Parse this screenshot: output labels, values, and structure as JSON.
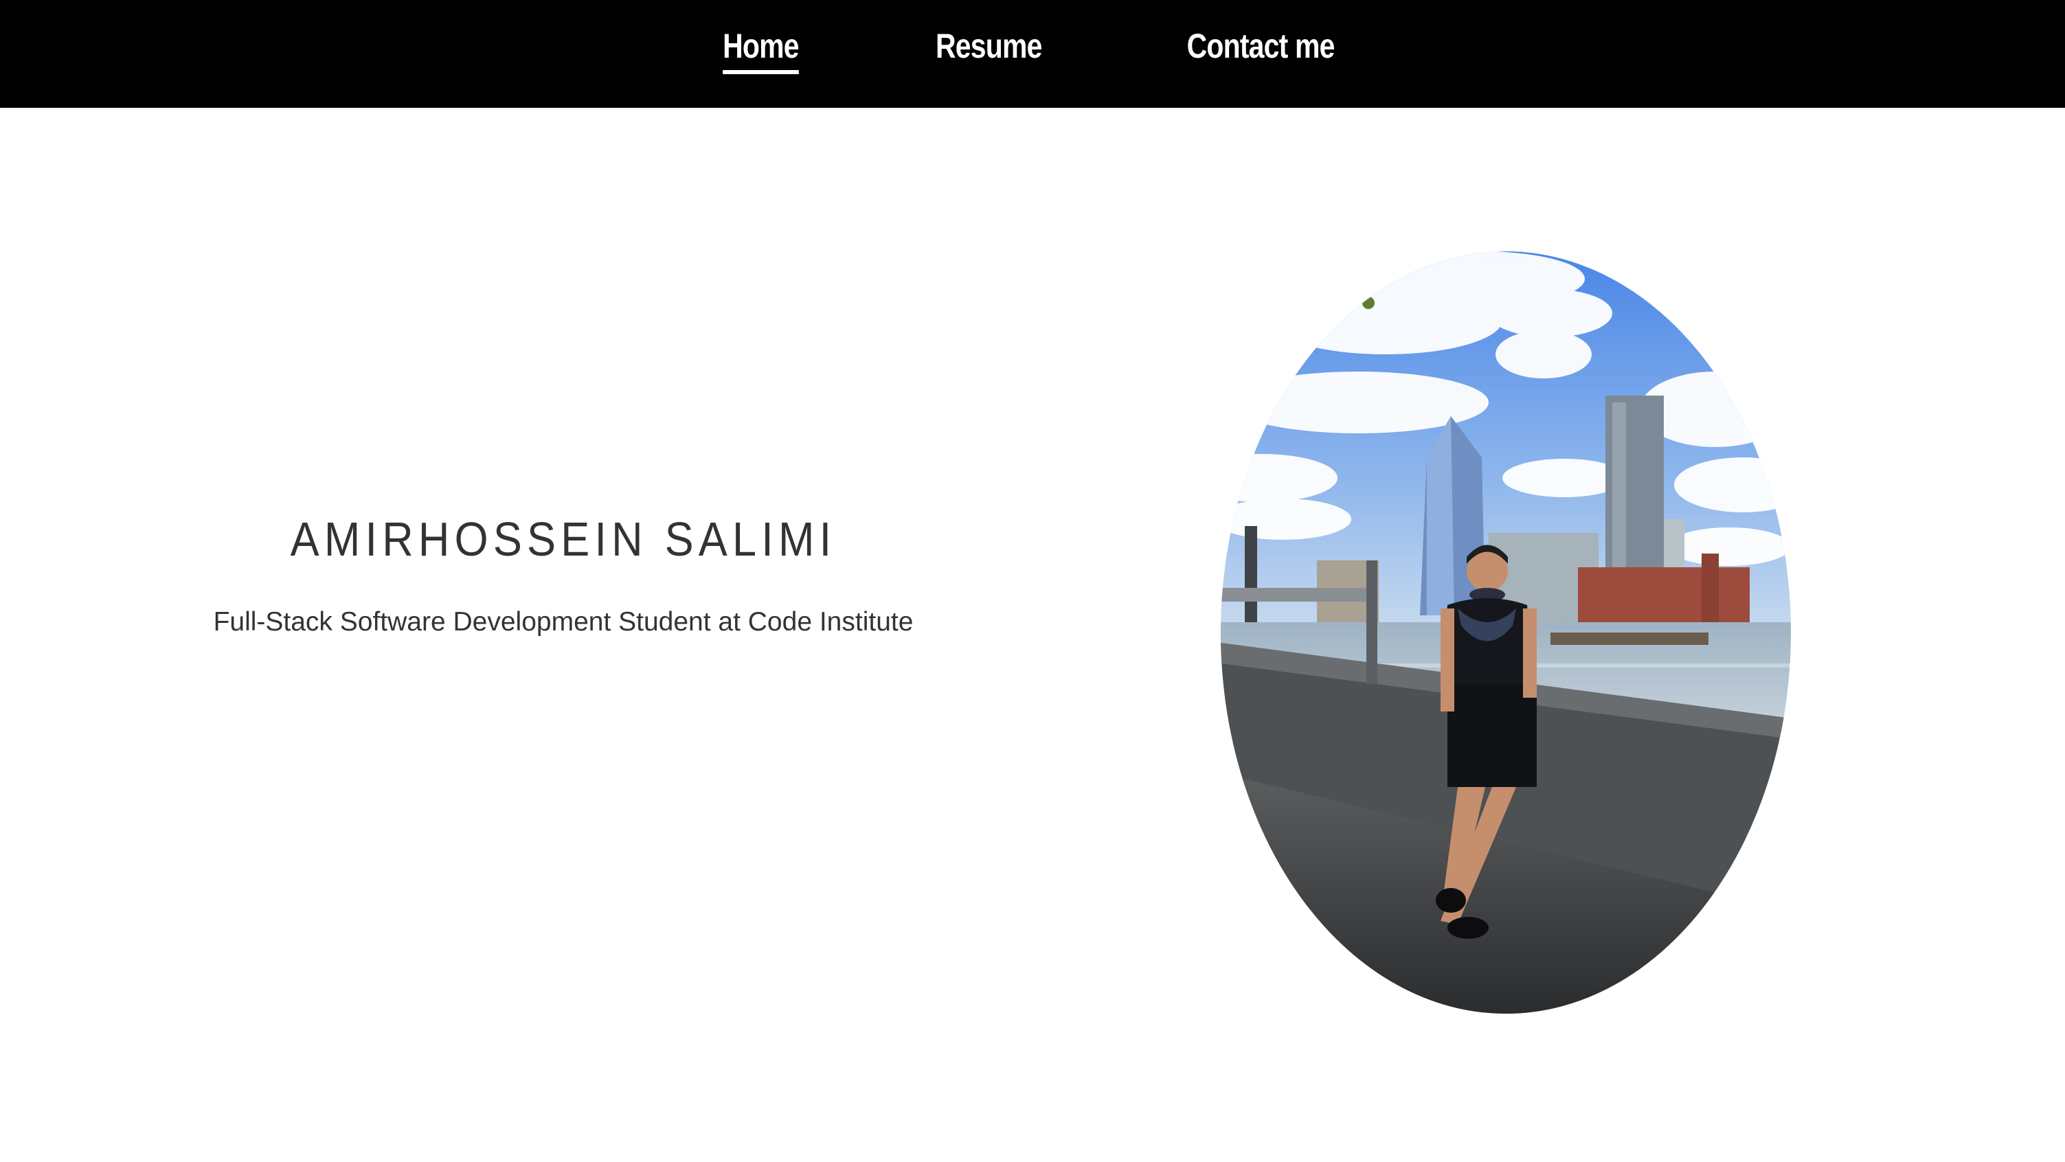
{
  "nav": {
    "items": [
      {
        "label": "Home",
        "active": true
      },
      {
        "label": "Resume",
        "active": false
      },
      {
        "label": "Contact me",
        "active": false
      }
    ]
  },
  "hero": {
    "name": "AMIRHOSSEIN SALIMI",
    "subtitle": "Full-Stack Software Development Student at Code Institute"
  },
  "colors": {
    "nav_background": "#000000",
    "nav_text": "#ffffff",
    "heading_text": "#333333",
    "page_background": "#ffffff"
  }
}
